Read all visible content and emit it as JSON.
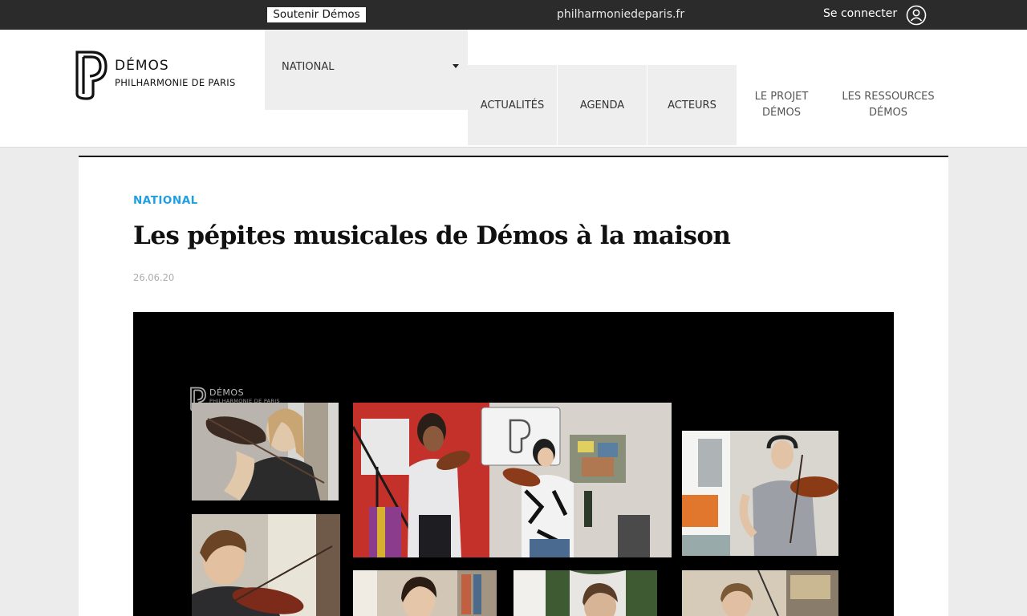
{
  "topbar": {
    "support_label": "Soutenir Démos",
    "site_link": "philharmoniedeparis.fr",
    "login_label": "Se connecter",
    "user_icon": "user-circle-icon"
  },
  "header": {
    "logo_title": "DÉMOS",
    "logo_subtitle": "PHILHARMONIE DE PARIS",
    "region_select": "NATIONAL",
    "nav": [
      {
        "label": "ACTUALITÉS"
      },
      {
        "label": "AGENDA"
      },
      {
        "label": "ACTEURS"
      },
      {
        "label": "LE PROJET DÉMOS"
      },
      {
        "label": "LES RESSOURCES DÉMOS"
      }
    ]
  },
  "article": {
    "category": "NATIONAL",
    "title": "Les pépites musicales de Démos à la maison",
    "date": "26.06.20"
  },
  "video": {
    "logo_title": "DÉMOS",
    "logo_subtitle": "PHILHARMONIE DE PARIS"
  },
  "colors": {
    "topbar_bg": "#2b2b2b",
    "accent": "#1f9fe0",
    "nav_bg": "#eeeeee",
    "page_bg": "#ececec"
  }
}
